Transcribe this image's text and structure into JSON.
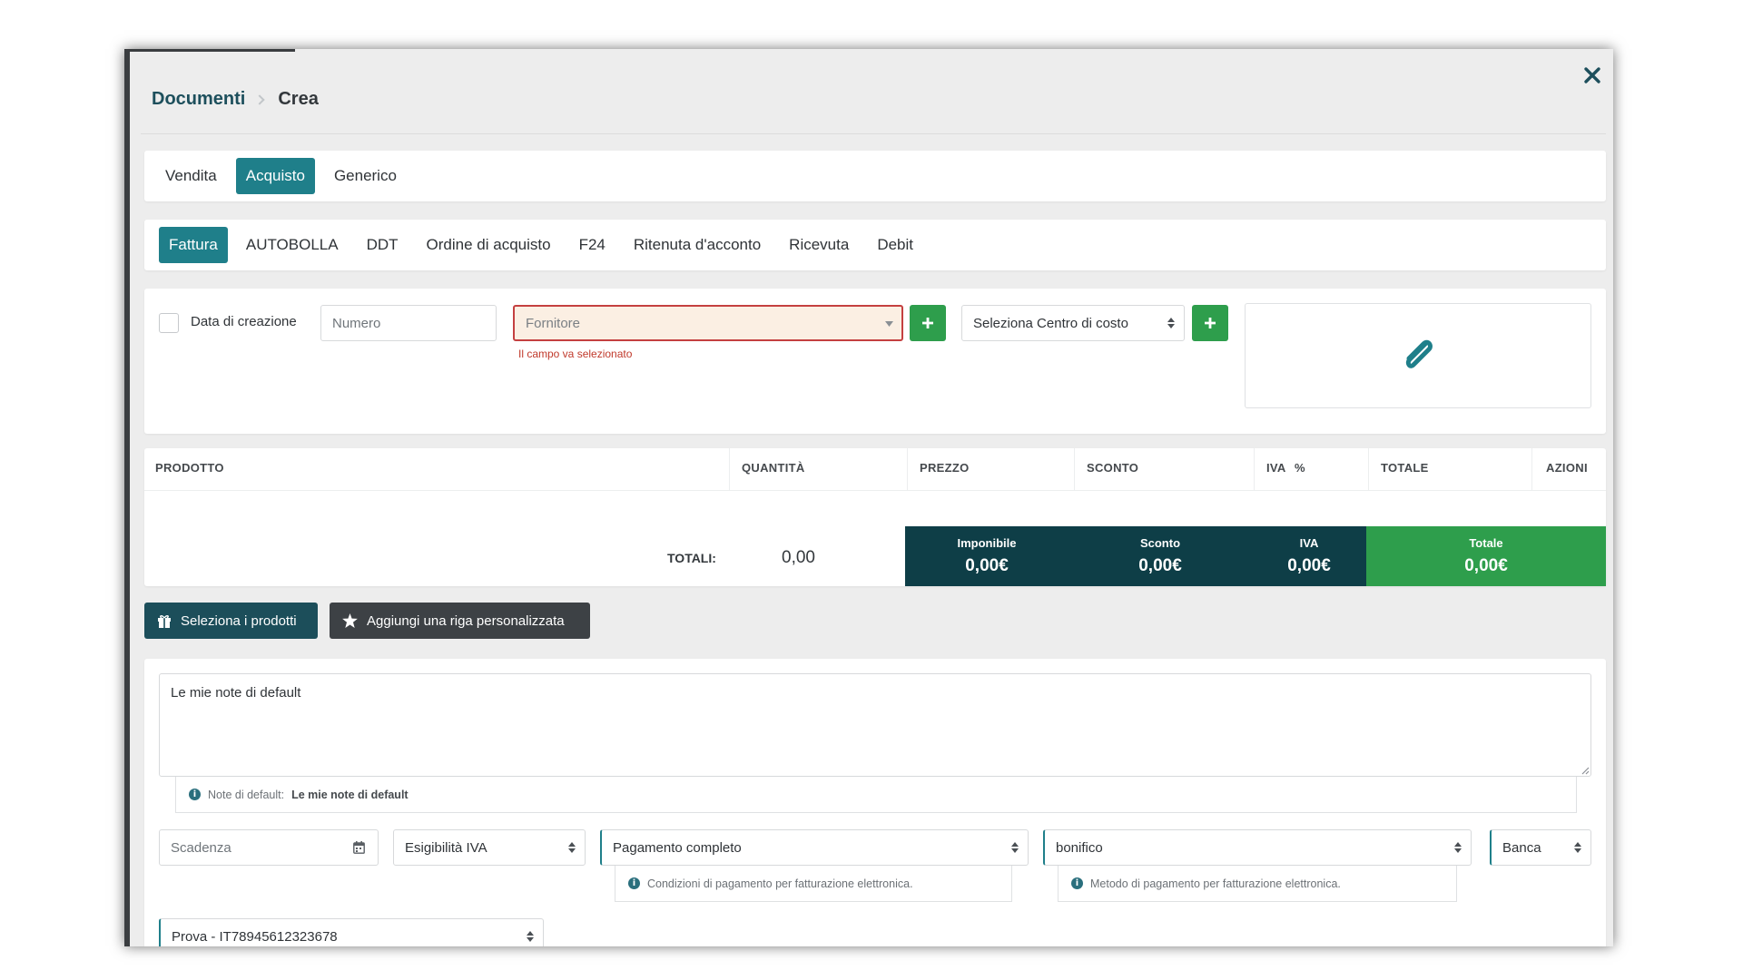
{
  "breadcrumb": {
    "root": "Documenti",
    "current": "Crea"
  },
  "category_tabs": [
    {
      "label": "Vendita",
      "active": false
    },
    {
      "label": "Acquisto",
      "active": true
    },
    {
      "label": "Generico",
      "active": false
    }
  ],
  "document_tabs": [
    {
      "label": "Fattura",
      "active": true
    },
    {
      "label": "AUTOBOLLA",
      "active": false
    },
    {
      "label": "DDT",
      "active": false
    },
    {
      "label": "Ordine di acquisto",
      "active": false
    },
    {
      "label": "F24",
      "active": false
    },
    {
      "label": "Ritenuta d'acconto",
      "active": false
    },
    {
      "label": "Ricevuta",
      "active": false
    },
    {
      "label": "Debit",
      "active": false
    }
  ],
  "form": {
    "creation_date_label": "Data di creazione",
    "creation_date_checked": false,
    "number_placeholder": "Numero",
    "supplier_placeholder": "Fornitore",
    "supplier_error": "Il campo va selezionato",
    "cost_center_placeholder": "Seleziona Centro di costo"
  },
  "table": {
    "headers": {
      "product": "PRODOTTO",
      "quantity": "QUANTITÀ",
      "price": "PREZZO",
      "discount": "SCONTO",
      "vat": "IVA",
      "vat_unit": "%",
      "total": "TOTALE",
      "actions": "AZIONI"
    },
    "totals_label": "TOTALI:",
    "totals_quantity": "0,00"
  },
  "summary": {
    "taxable_label": "Imponibile",
    "taxable_value": "0,00€",
    "discount_label": "Sconto",
    "discount_value": "0,00€",
    "vat_label": "IVA",
    "vat_value": "0,00€",
    "total_label": "Totale",
    "total_value": "0,00€"
  },
  "actions": {
    "select_products": "Seleziona i prodotti",
    "add_custom_row": "Aggiungi una riga personalizzata"
  },
  "notes": {
    "value": "Le mie note di default",
    "help_prefix": "Note di default:",
    "help_value": "Le mie note di default"
  },
  "payment": {
    "due_date_placeholder": "Scadenza",
    "vat_eligibility": "Esigibilità IVA",
    "payment_terms": "Pagamento completo",
    "payment_terms_help": "Condizioni di pagamento per fatturazione elettronica.",
    "payment_method": "bonifico",
    "payment_method_help": "Metodo di pagamento per fatturazione elettronica.",
    "bank": "Banca",
    "account": "Prova - IT78945612323678"
  },
  "colors": {
    "primary": "#1f7f8a",
    "dark": "#1c4e5a",
    "summary_dark": "#0e3e47",
    "success": "#2e9e4c",
    "error": "#c44040"
  }
}
